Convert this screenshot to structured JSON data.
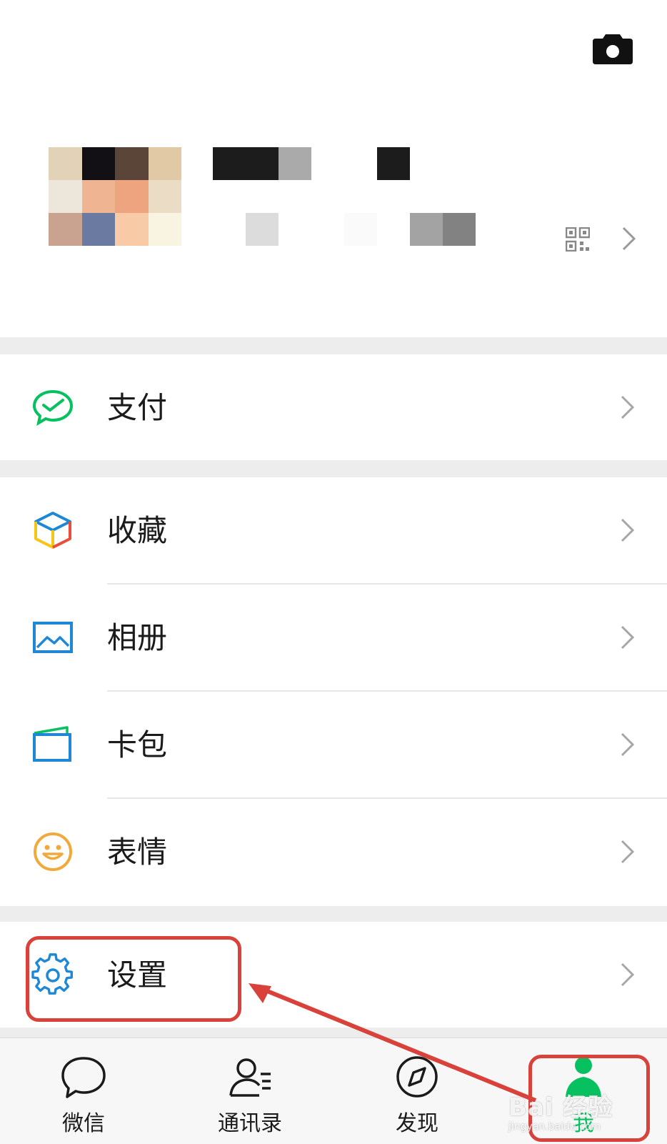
{
  "profile": {
    "camera_icon": "camera-icon",
    "qr_icon": "qr-code-icon"
  },
  "menu": {
    "pay": {
      "label": "支付",
      "icon": "wechat-pay-icon",
      "color": "#07c160"
    },
    "favorites": {
      "label": "收藏",
      "icon": "cube-icon"
    },
    "album": {
      "label": "相册",
      "icon": "photo-album-icon",
      "color": "#1e88d6"
    },
    "cards": {
      "label": "卡包",
      "icon": "card-wallet-icon",
      "color": "#1e88d6"
    },
    "stickers": {
      "label": "表情",
      "icon": "smiley-icon",
      "color": "#f2a93b"
    },
    "settings": {
      "label": "设置",
      "icon": "gear-icon",
      "color": "#1e88d6"
    }
  },
  "tabbar": {
    "tabs": [
      {
        "label": "微信",
        "icon": "chat-bubble-icon",
        "active": false
      },
      {
        "label": "通讯录",
        "icon": "contacts-icon",
        "active": false
      },
      {
        "label": "发现",
        "icon": "compass-icon",
        "active": false
      },
      {
        "label": "我",
        "icon": "me-person-icon",
        "active": true
      }
    ],
    "active_color": "#07c160"
  },
  "annotation": {
    "color": "#d8423a"
  },
  "watermark": {
    "brand": "Bai 经验",
    "url": "jingyan.baidu.com"
  }
}
